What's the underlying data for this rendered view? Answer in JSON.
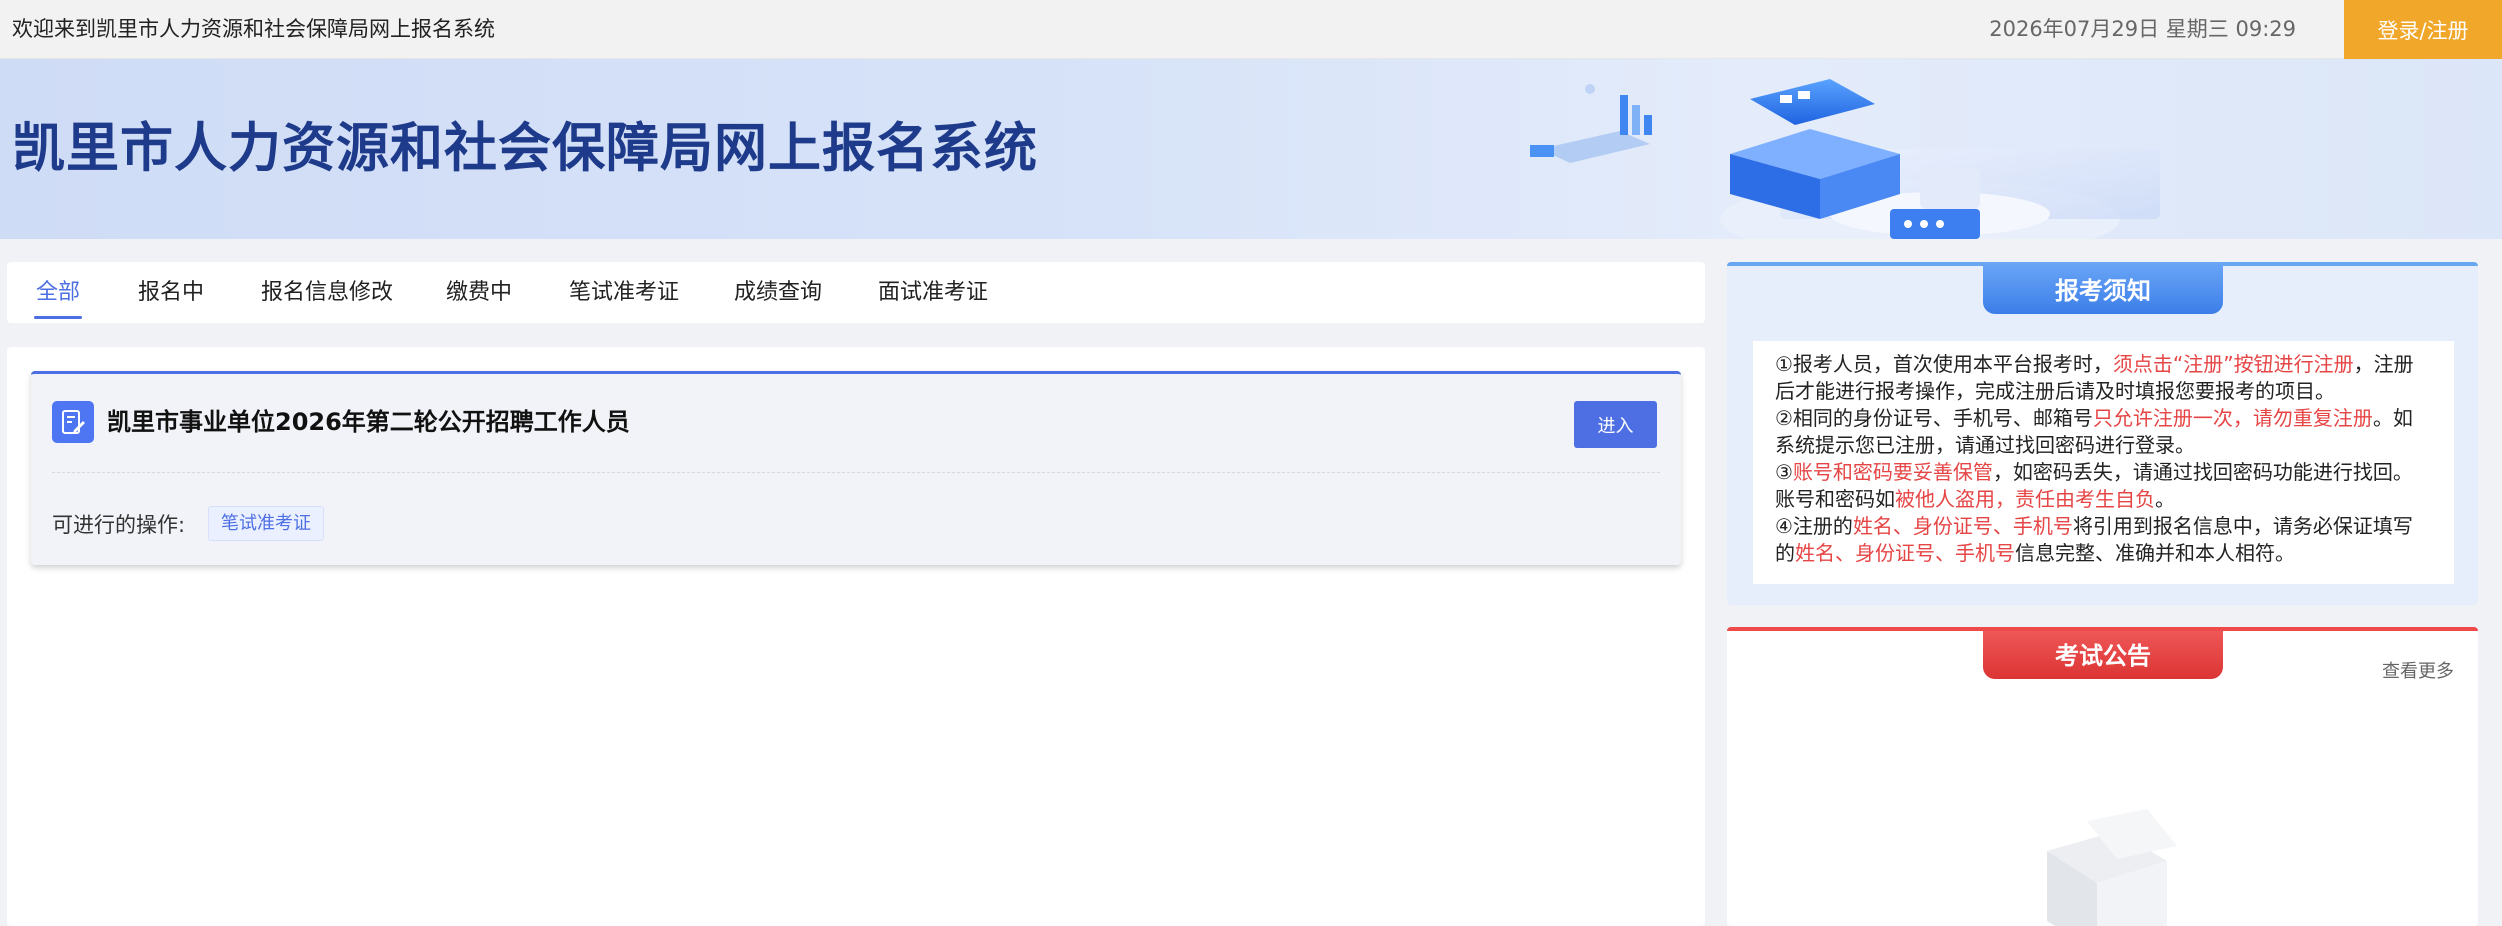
{
  "topbar": {
    "welcome": "欢迎来到凯里市人力资源和社会保障局网上报名系统",
    "datetime": "2026年07月29日 星期三 09:29",
    "login_label": "登录/注册"
  },
  "banner": {
    "title": "凯里市人力资源和社会保障局网上报名系统"
  },
  "tabs": [
    {
      "label": "全部",
      "active": true
    },
    {
      "label": "报名中"
    },
    {
      "label": "报名信息修改"
    },
    {
      "label": "缴费中"
    },
    {
      "label": "笔试准考证"
    },
    {
      "label": "成绩查询"
    },
    {
      "label": "面试准考证"
    }
  ],
  "exam": {
    "title": "凯里市事业单位2026年第二轮公开招聘工作人员",
    "enter_label": "进入",
    "ops_label": "可进行的操作:",
    "ops": [
      "笔试准考证"
    ]
  },
  "notice": {
    "title": "报考须知",
    "p1_a": "①报考人员，首次使用本平台报考时，",
    "p1_red": "须点击“注册”按钮进行注册",
    "p1_b": "，注册后才能进行报考操作，完成注册后请及时填报您要报考的项目。",
    "p2_a": "②相同的身份证号、手机号、邮箱号",
    "p2_red": "只允许注册一次，请勿重复注册",
    "p2_b": "。如系统提示您已注册，请通过找回密码进行登录。",
    "p3_a": "③",
    "p3_red1": "账号和密码要妥善保管",
    "p3_b": "，如密码丢失，请通过找回密码功能进行找回。账号和密码如",
    "p3_red2": "被他人盗用，责任由考生自负",
    "p3_c": "。",
    "p4_a": "④注册的",
    "p4_red1": "姓名、身份证号、手机号",
    "p4_b": "将引用到报名信息中，请务必保证填写的",
    "p4_red2": "姓名、身份证号、手机号",
    "p4_c": "信息完整、准确并和本人相符。"
  },
  "announce": {
    "title": "考试公告",
    "more_label": "查看更多"
  },
  "colors": {
    "primary": "#4e6fe3",
    "login_bg": "#f0a72a",
    "title_blue": "#1e3a8a",
    "notice_blue": "#3b7ee8",
    "announce_red": "#dc3434",
    "emphasis_red": "#e64545"
  }
}
